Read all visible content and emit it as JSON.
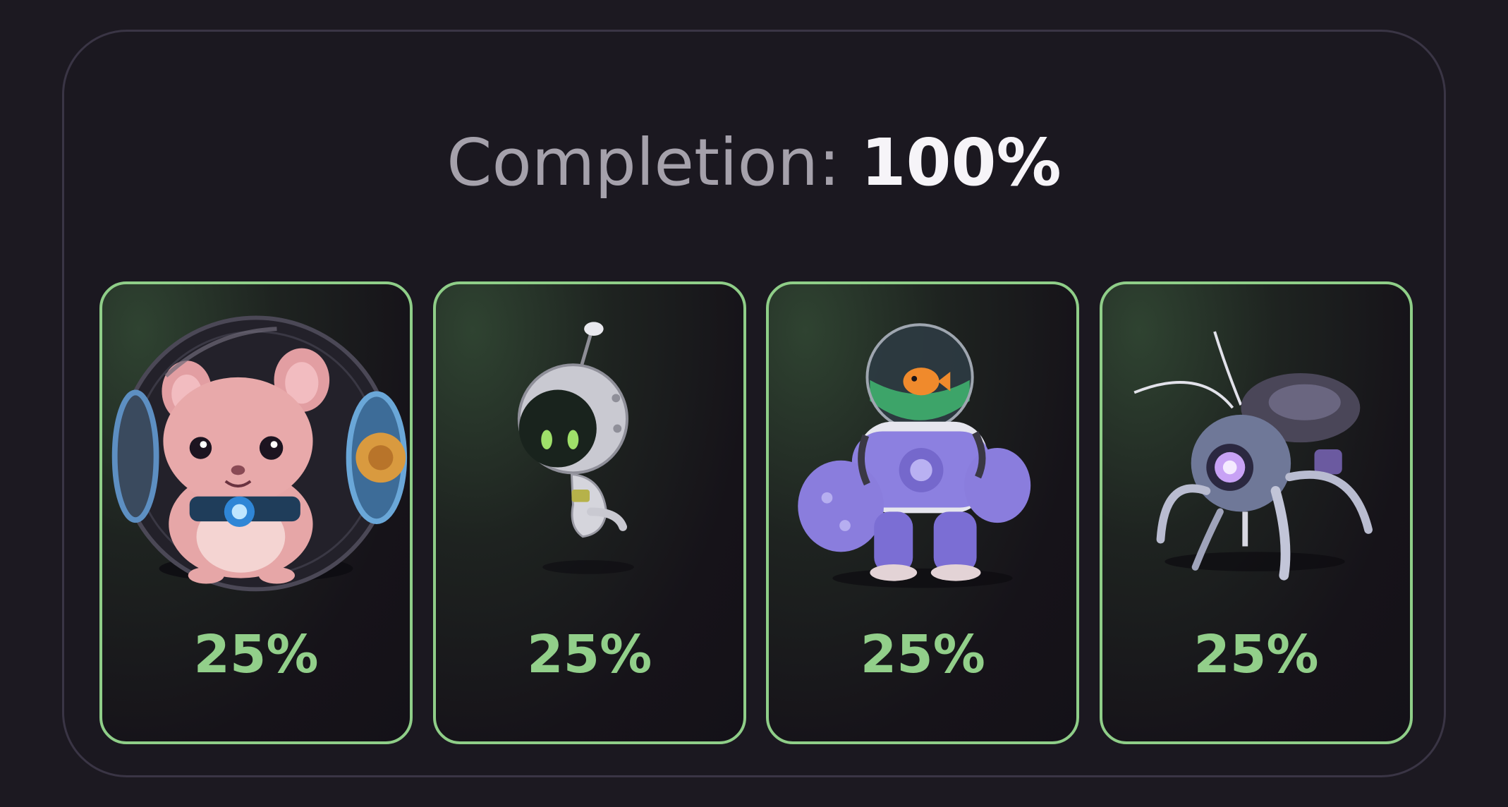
{
  "completion": {
    "label": "Completion:",
    "value": "100%"
  },
  "cards": [
    {
      "character_icon": "hamster-in-ball-icon",
      "percent": "25%"
    },
    {
      "character_icon": "astronaut-robot-icon",
      "percent": "25%"
    },
    {
      "character_icon": "fishbowl-mech-icon",
      "percent": "25%"
    },
    {
      "character_icon": "spider-bot-icon",
      "percent": "25%"
    }
  ],
  "colors": {
    "background": "#1c1921",
    "card_border": "#8fce88",
    "percent_text": "#92cf8a",
    "label_text": "#a5a1ab",
    "value_text": "#f6f4f8"
  }
}
